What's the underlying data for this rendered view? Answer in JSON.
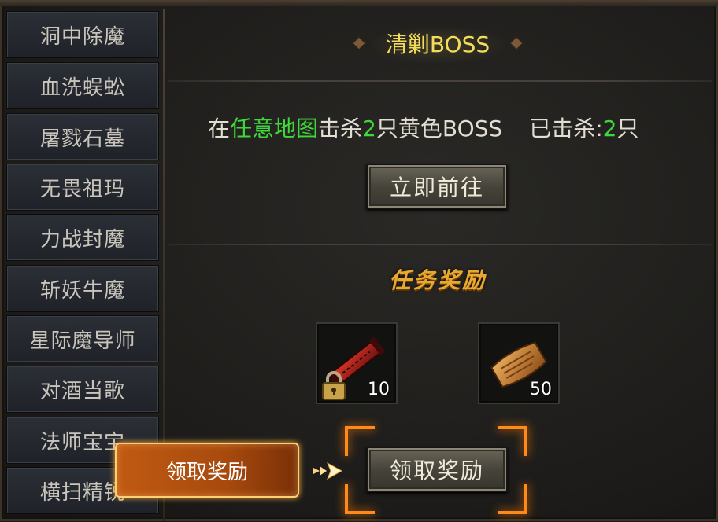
{
  "sidebar": {
    "items": [
      {
        "label": "洞中除魔"
      },
      {
        "label": "血洗蜈蚣"
      },
      {
        "label": "屠戮石墓"
      },
      {
        "label": "无畏祖玛"
      },
      {
        "label": "力战封魔"
      },
      {
        "label": "斩妖牛魔"
      },
      {
        "label": "星际魔导师"
      },
      {
        "label": "对酒当歌"
      },
      {
        "label": "法师宝宝"
      },
      {
        "label": "横扫精锐"
      }
    ]
  },
  "quest": {
    "title": "清剿BOSS",
    "desc_prefix": "在",
    "desc_location": "任意地图",
    "desc_mid": "击杀",
    "desc_count": "2",
    "desc_target": "只黄色BOSS",
    "progress_label": "已击杀:",
    "progress_value": "2",
    "progress_unit": "只",
    "goto_button": "立即前往"
  },
  "rewards": {
    "title": "任务奖励",
    "items": [
      {
        "icon": "red-scroll-icon",
        "count": "10",
        "locked": true
      },
      {
        "icon": "paper-scroll-icon",
        "count": "50",
        "locked": false
      }
    ],
    "claim_button": "领取奖励"
  },
  "tutorial": {
    "tip_text": "领取奖励"
  },
  "colors": {
    "title": "#f3dc5a",
    "highlight_green": "#3fd83a",
    "reward_title": "#e7a92f",
    "guide_orange": "#ff8a1a"
  }
}
